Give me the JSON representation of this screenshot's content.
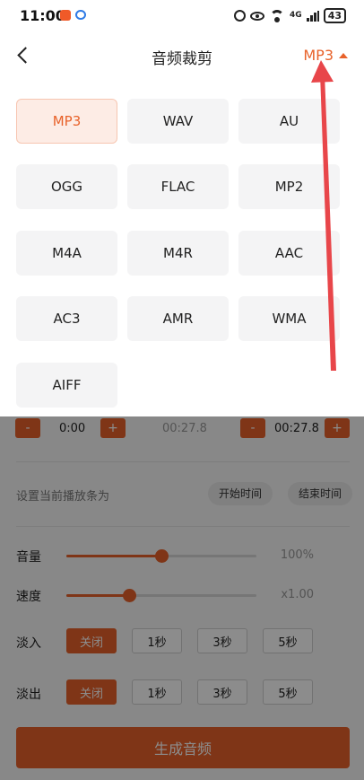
{
  "status_bar": {
    "time": "11:00",
    "network": "4G",
    "battery": "43"
  },
  "header": {
    "title": "音频裁剪",
    "format_selected": "MP3"
  },
  "formats": [
    "MP3",
    "WAV",
    "AU",
    "OGG",
    "FLAC",
    "MP2",
    "M4A",
    "M4R",
    "AAC",
    "AC3",
    "AMR",
    "WMA",
    "AIFF"
  ],
  "selected_format": "MP3",
  "trim": {
    "minus": "-",
    "plus": "+",
    "start_time": "0:00",
    "middle_time": "00:27.8",
    "end_time": "00:27.8"
  },
  "playhead": {
    "label": "设置当前播放条为",
    "start_button": "开始时间",
    "end_button": "结束时间"
  },
  "volume": {
    "label": "音量",
    "value_text": "100%",
    "fraction": 0.5
  },
  "speed": {
    "label": "速度",
    "value_text": "x1.00",
    "fraction": 0.33
  },
  "fade_in": {
    "label": "淡入",
    "options": [
      "关闭",
      "1秒",
      "3秒",
      "5秒"
    ],
    "active": 0
  },
  "fade_out": {
    "label": "淡出",
    "options": [
      "关闭",
      "1秒",
      "3秒",
      "5秒"
    ],
    "active": 0
  },
  "generate_button": "生成音频",
  "colors": {
    "accent": "#e8622a",
    "annotation": "#e8464a"
  }
}
